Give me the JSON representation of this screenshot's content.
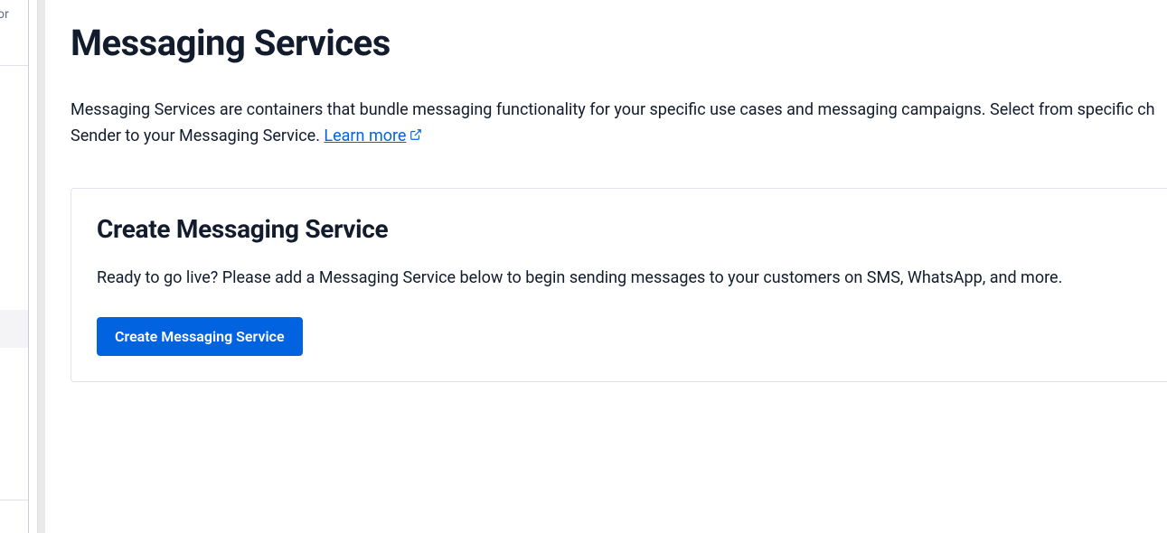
{
  "sidebar": {
    "fragment_text": "or",
    "active_item": true
  },
  "page": {
    "title": "Messaging Services",
    "description_part1": "Messaging Services are containers that bundle messaging functionality for your specific use cases and messaging campaigns. Select from specific ch",
    "description_part2": "Sender to your Messaging Service. ",
    "learn_more_label": "Learn more"
  },
  "card": {
    "title": "Create Messaging Service",
    "description": "Ready to go live? Please add a Messaging Service below to begin sending messages to your customers on SMS, WhatsApp, and more.",
    "button_label": "Create Messaging Service"
  }
}
